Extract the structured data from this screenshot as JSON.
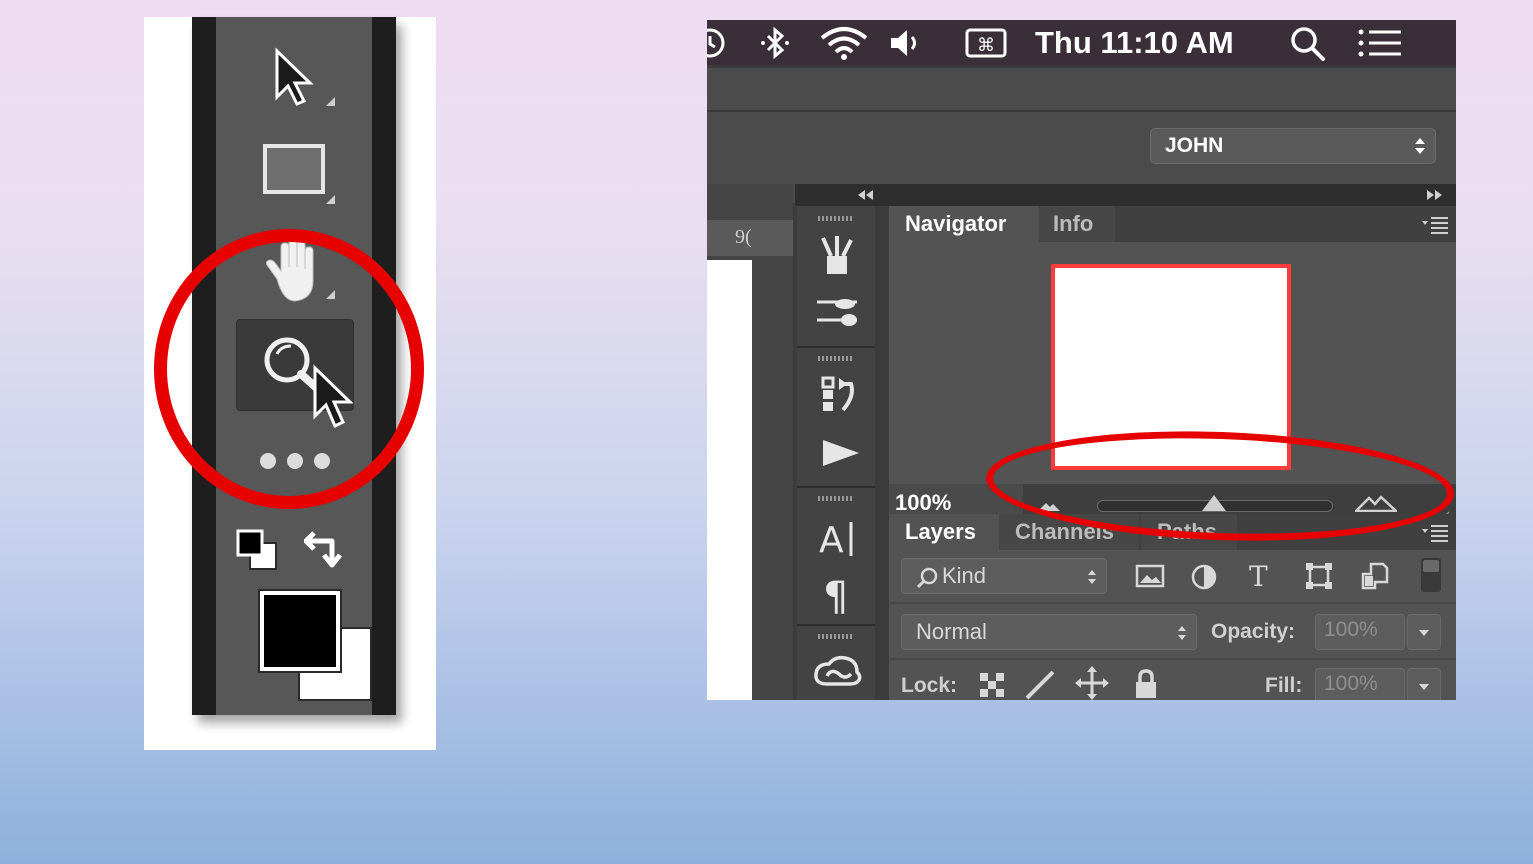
{
  "toolbar": {
    "tools": [
      "selection-arrow",
      "rectangle-marquee",
      "hand",
      "zoom",
      "more"
    ],
    "highlighted_tool": "zoom",
    "foreground_color": "#000000",
    "background_color": "#ffffff"
  },
  "menubar": {
    "clock": "Thu 11:10 AM"
  },
  "workspace": {
    "selected": "JOHN"
  },
  "ruler": {
    "visible_text": "9("
  },
  "navigator": {
    "tabs": [
      "Navigator",
      "Info"
    ],
    "zoom_level": "100%",
    "slider_position": 0.5
  },
  "layers": {
    "tabs": [
      "Layers",
      "Channels",
      "Paths"
    ],
    "filter_kind": "Kind",
    "blend_mode": "Normal",
    "opacity_label": "Opacity:",
    "opacity_value": "100%",
    "lock_label": "Lock:",
    "fill_label": "Fill:",
    "fill_value": "100%"
  },
  "annotation_color": "#e60000"
}
